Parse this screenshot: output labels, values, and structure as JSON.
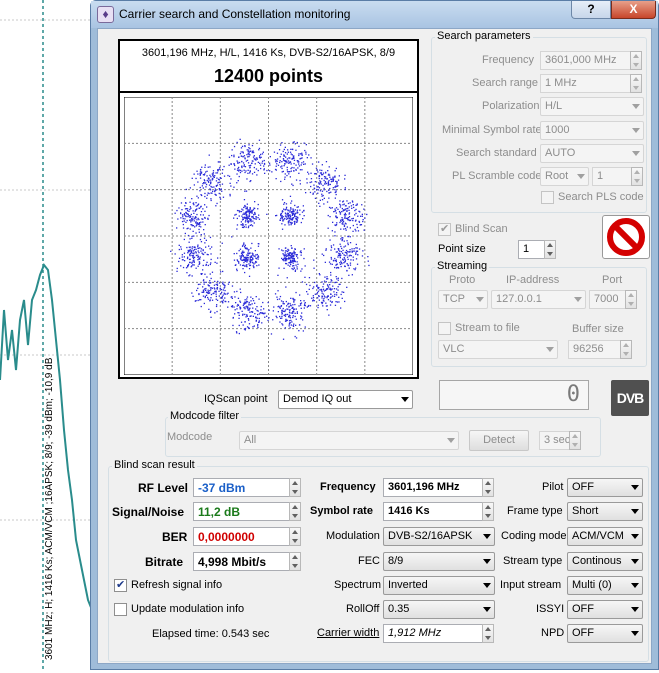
{
  "window": {
    "title": "Carrier search and Constellation monitoring",
    "help_label": "?",
    "close_label": "X"
  },
  "background": {
    "vertical_text": "3601 MHz; H; 1416 Ks; ACM/VCM ;16APSK; 8/9; -39 dBm; -10,9 dB"
  },
  "constellation": {
    "info": "3601,196 MHz, H/L, 1416 Ks, DVB-S2/16APSK, 8/9",
    "points": "12400 points"
  },
  "search_params": {
    "title": "Search parameters",
    "frequency_label": "Frequency",
    "frequency_value": "3601,000 MHz",
    "range_label": "Search range",
    "range_value": "1 MHz",
    "polarization_label": "Polarization",
    "polarization_value": "H/L",
    "min_sr_label": "Minimal Symbol rate",
    "min_sr_value": "1000",
    "standard_label": "Search standard",
    "standard_value": "AUTO",
    "pl_label": "PL Scramble code",
    "pl_mode": "Root",
    "pl_value": "1",
    "search_pls_label": "Search PLS code"
  },
  "blind_scan_label": "Blind Scan",
  "point_size_label": "Point size",
  "point_size_value": "1",
  "streaming": {
    "title": "Streaming",
    "proto_label": "Proto",
    "ip_label": "IP-address",
    "port_label": "Port",
    "proto_value": "TCP",
    "ip_value": "127.0.0.1",
    "port_value": "7000",
    "stream_to_file_label": "Stream to file",
    "buffer_label": "Buffer size",
    "player_value": "VLC",
    "buffer_value": "96256"
  },
  "counter_value": "0",
  "dvb_logo": "DVB",
  "iqscan_label": "IQScan point",
  "iqscan_value": "Demod IQ out",
  "modcode": {
    "title": "Modcode filter",
    "label": "Modcode",
    "value": "All",
    "detect_label": "Detect",
    "interval_value": "3 sec"
  },
  "result": {
    "title": "Blind scan result",
    "rf_label": "RF Level",
    "rf_value": "-37 dBm",
    "sn_label": "Signal/Noise",
    "sn_value": "11,2 dB",
    "ber_label": "BER",
    "ber_value": "0,0000000",
    "bitrate_label": "Bitrate",
    "bitrate_value": "4,998 Mbit/s",
    "refresh_label": "Refresh signal info",
    "update_label": "Update modulation info",
    "elapsed": "Elapsed time: 0.543 sec",
    "freq_label": "Frequency",
    "freq_value": "3601,196 MHz",
    "sr_label": "Symbol rate",
    "sr_value": "1416 Ks",
    "mod_label": "Modulation",
    "mod_value": "DVB-S2/16APSK",
    "fec_label": "FEC",
    "fec_value": "8/9",
    "spectrum_label": "Spectrum",
    "spectrum_value": "Inverted",
    "rolloff_label": "RollOff",
    "rolloff_value": "0.35",
    "cw_label": "Carrier width",
    "cw_value": "1,912 MHz",
    "pilot_label": "Pilot",
    "pilot_value": "OFF",
    "frame_label": "Frame type",
    "frame_value": "Short",
    "coding_label": "Coding mode",
    "coding_value": "ACM/VCM",
    "stype_label": "Stream type",
    "stype_value": "Continous",
    "istream_label": "Input stream",
    "istream_value": "Multi (0)",
    "issyi_label": "ISSYI",
    "issyi_value": "OFF",
    "npd_label": "NPD",
    "npd_value": "OFF"
  },
  "colors": {
    "rf": "#1a5fc8",
    "sn": "#1a7a1a",
    "ber": "#d00000",
    "points": "#2a2ad8",
    "trace": "#2a8c8c"
  }
}
